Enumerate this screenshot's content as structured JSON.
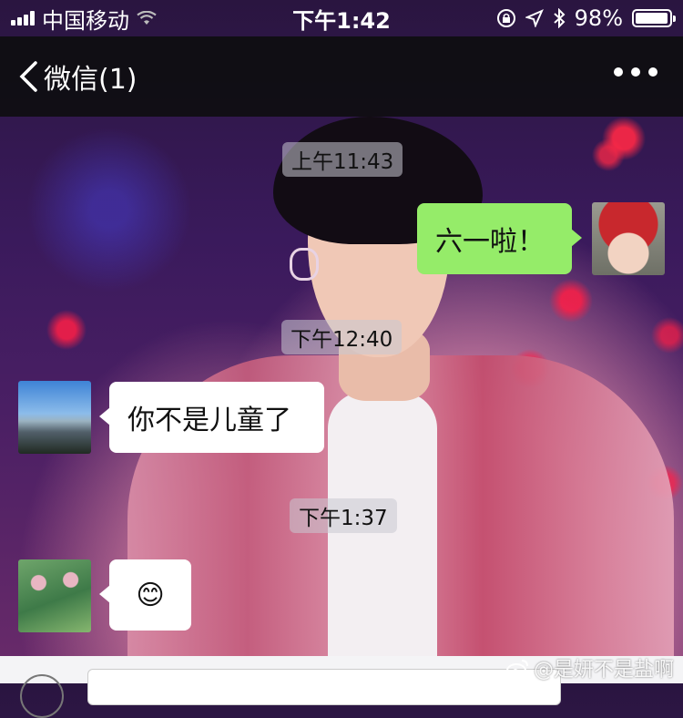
{
  "status_bar": {
    "carrier": "中国移动",
    "time": "下午1:42",
    "battery_percent": "98%",
    "battery_level": 0.98
  },
  "nav": {
    "back_label": "微信(1)"
  },
  "messages": [
    {
      "timestamp": "上午11:43"
    },
    {
      "direction": "out",
      "text": "六一啦！"
    },
    {
      "timestamp": "下午12:40"
    },
    {
      "direction": "in",
      "text": "你不是儿童了"
    },
    {
      "timestamp": "下午1:37"
    },
    {
      "direction": "in",
      "text": "😊"
    }
  ],
  "watermark": "@是妍不是盐啊",
  "icons": {
    "signal": "signal-bars-icon",
    "wifi": "wifi-icon",
    "lock_rotation": "rotation-lock-icon",
    "location": "location-arrow-icon",
    "bluetooth": "bluetooth-icon",
    "battery": "battery-icon",
    "back": "chevron-left-icon",
    "more": "more-dots-icon",
    "voice": "voice-icon"
  },
  "colors": {
    "outgoing_bubble": "#95ec69",
    "incoming_bubble": "#ffffff",
    "nav_background": "#0e0e10"
  }
}
